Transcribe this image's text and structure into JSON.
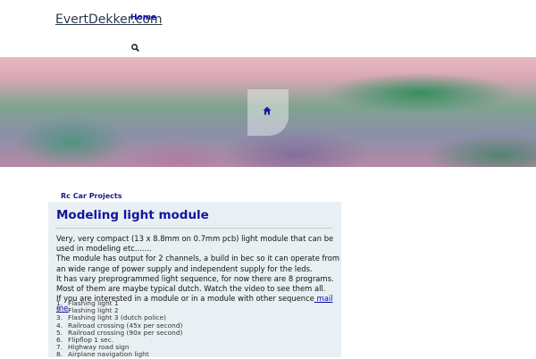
{
  "header": {
    "logo": "EvertDekker.com",
    "nav_home": "Home"
  },
  "breadcrumb": "Rc Car Projects",
  "article": {
    "title": "Modeling light module",
    "line1": "Very, very compact (13 x 8.8mm on 0.7mm pcb)  light module that can be used in modeling etc.......",
    "line2": "The module has output for 2 channels, a build in bec so it can operate from an wide range of power supply and independent supply for the leds.",
    "line3": "It has vary preprogrammed light sequence, for now there are 8 programs. Most of them are maybe typical dutch. Watch the video to see them all.",
    "line4_prefix": "If you are interested in a module or in a module with other sequence",
    "line4_link": " mail me",
    "line4_suffix": ".",
    "programs": [
      "Flashing light 1",
      "Flashing light 2",
      "Flashing light 3 (dutch police)",
      "Railroad crossing (45x per second)",
      "Railroad crossing (90x per second)",
      "Flipflop 1 sec.",
      "Highway road sign",
      "Airplane navigation light"
    ]
  },
  "icons": {
    "search": "search-icon",
    "home": "home-icon"
  },
  "colors": {
    "link": "#0a0aa8",
    "title": "#14149e",
    "panel": "#e9f0f3"
  }
}
